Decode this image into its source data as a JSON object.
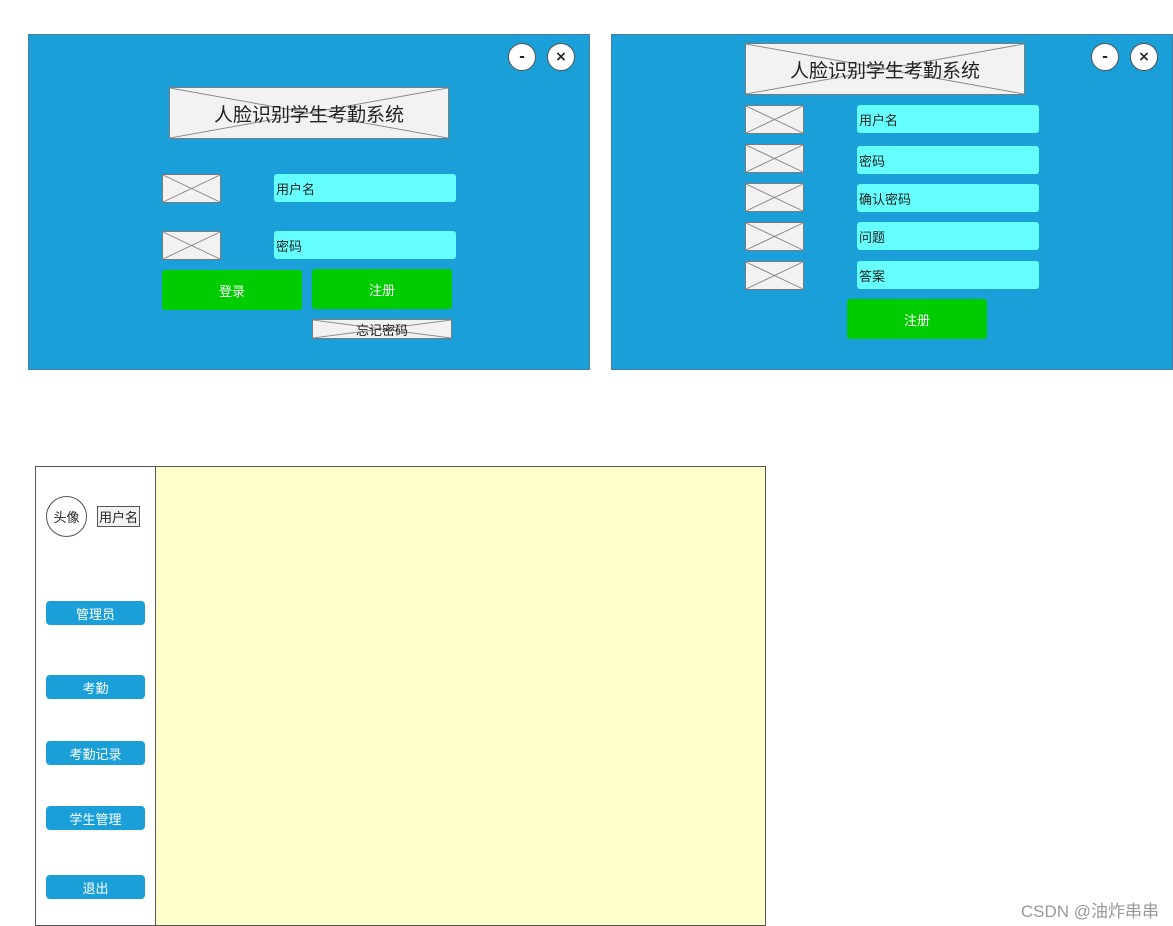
{
  "login_window": {
    "minimize_label": "-",
    "close_label": "×",
    "title": "人脸识别学生考勤系统",
    "username_placeholder": "用户名",
    "password_placeholder": "密码",
    "login_button": "登录",
    "register_button": "注册",
    "forgot_password": "忘记密码"
  },
  "register_window": {
    "minimize_label": "-",
    "close_label": "×",
    "title": "人脸识别学生考勤系统",
    "fields": [
      "用户名",
      "密码",
      "确认密码",
      "问题",
      "答案"
    ],
    "register_button": "注册"
  },
  "main_window": {
    "avatar_label": "头像",
    "username_label": "用户名",
    "nav_items": [
      "管理员",
      "考勤",
      "考勤记录",
      "学生管理",
      "退出"
    ]
  },
  "watermark": "CSDN @油炸串串",
  "colors": {
    "panel_blue": "#1a9fd9",
    "field_cyan": "#66ffff",
    "button_green": "#00cc00",
    "content_yellow": "#ffffcc"
  }
}
